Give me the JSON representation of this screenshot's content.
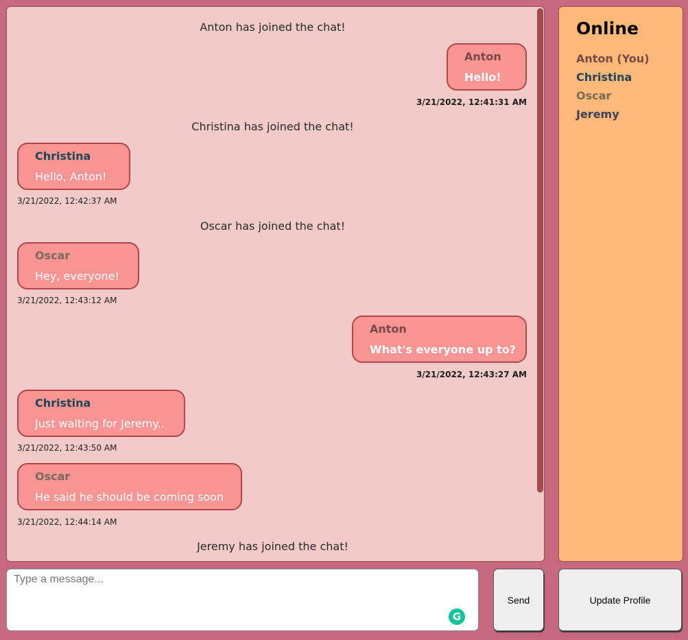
{
  "chat": {
    "system": [
      "Anton has joined the chat!",
      "Christina has joined the chat!",
      "Oscar has joined the chat!",
      "Jeremy has joined the chat!"
    ],
    "messages": [
      {
        "sender": "Anton",
        "text": "Hello!",
        "timestamp": "3/21/2022, 12:41:31 AM",
        "mine": true
      },
      {
        "sender": "Christina",
        "text": "Hello, Anton!",
        "timestamp": "3/21/2022, 12:42:37 AM",
        "mine": false
      },
      {
        "sender": "Oscar",
        "text": "Hey, everyone!",
        "timestamp": "3/21/2022, 12:43:12 AM",
        "mine": false
      },
      {
        "sender": "Anton",
        "text": "What's everyone up to?",
        "timestamp": "3/21/2022, 12:43:27 AM",
        "mine": true
      },
      {
        "sender": "Christina",
        "text": "Just waiting for Jeremy..",
        "timestamp": "3/21/2022, 12:43:50 AM",
        "mine": false
      },
      {
        "sender": "Oscar",
        "text": "He said he should be coming soon",
        "timestamp": "3/21/2022, 12:44:14 AM",
        "mine": false
      }
    ]
  },
  "online": {
    "title": "Online",
    "users": [
      {
        "name": "Anton (You)",
        "color": "#7a4848"
      },
      {
        "name": "Christina",
        "color": "#1f4655"
      },
      {
        "name": "Oscar",
        "color": "#7a6a58"
      },
      {
        "name": "Jeremy",
        "color": "#3f3f5a"
      }
    ]
  },
  "colors": {
    "Anton": "#7a4848",
    "Christina": "#1f4655",
    "Oscar": "#7a6a58"
  },
  "composer": {
    "placeholder": "Type a message...",
    "send_label": "Send",
    "update_profile_label": "Update Profile",
    "grammarly_icon": "G"
  }
}
